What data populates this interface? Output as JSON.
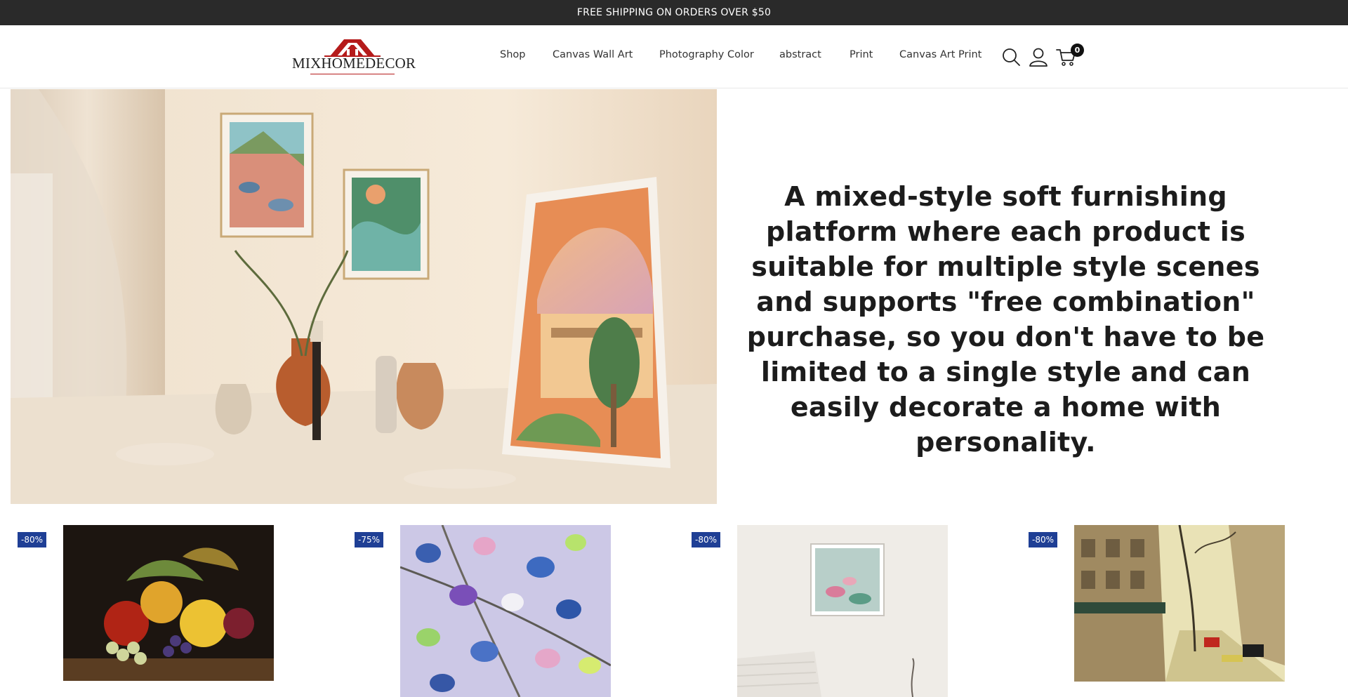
{
  "announcement": {
    "text": "FREE SHIPPING ON ORDERS OVER $50"
  },
  "header": {
    "logo_text": "MIXHOMEDECOR",
    "nav": [
      {
        "label": "Shop"
      },
      {
        "label": "Canvas Wall Art"
      },
      {
        "label": "Photography Color"
      },
      {
        "label": "abstract"
      },
      {
        "label": "Print"
      },
      {
        "label": "Canvas Art Print"
      }
    ],
    "icons": {
      "search": "search-icon",
      "account": "user-icon",
      "cart": "cart-icon"
    },
    "cart_count": "0"
  },
  "hero": {
    "text": "A mixed-style soft furnishing platform where each product is suitable for multiple style scenes and supports \"free combination\" purchase, so you don't have to be limited to a single style and can easily decorate a home with personality."
  },
  "products": [
    {
      "discount": "-80%"
    },
    {
      "discount": "-75%"
    },
    {
      "discount": "-80%"
    },
    {
      "discount": "-80%"
    }
  ],
  "colors": {
    "announcement_bg": "#2a2a2a",
    "badge_bg": "#1f3f95",
    "logo_red": "#b51b1b"
  }
}
